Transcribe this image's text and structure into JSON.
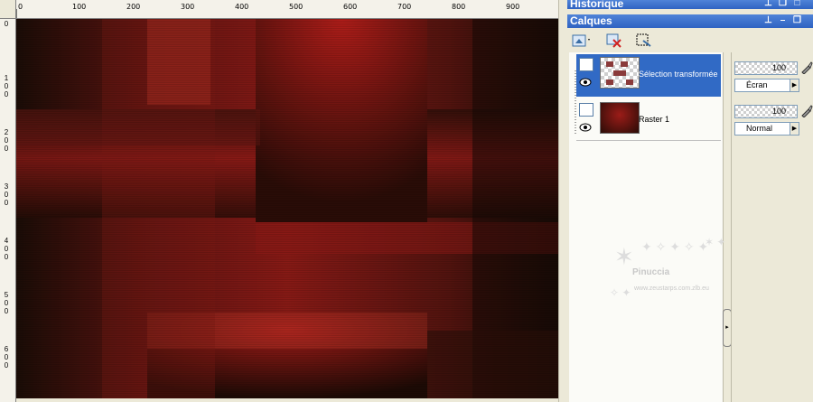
{
  "rulers": {
    "top_labels": [
      "0",
      "100",
      "200",
      "300",
      "400",
      "500",
      "600",
      "700",
      "800",
      "900"
    ],
    "left_labels": [
      "0",
      "100",
      "200",
      "300",
      "400",
      "500",
      "600"
    ]
  },
  "panels": {
    "historique": {
      "title": "Historique"
    },
    "calques": {
      "title": "Calques"
    }
  },
  "layers": [
    {
      "name": "Sélection transformée",
      "opacity": "100",
      "blend": "Écran",
      "selected": true
    },
    {
      "name": "Raster 1",
      "opacity": "100",
      "blend": "Normal",
      "selected": false
    }
  ],
  "watermark": {
    "name": "Pinuccia",
    "url": "www.zeustarps.com.zlb.eu"
  },
  "colors": {
    "titlebar": "#2f63c2",
    "selection": "#316ac5",
    "canvas_red": "#a81d1a",
    "canvas_dark": "#1a0d07"
  }
}
